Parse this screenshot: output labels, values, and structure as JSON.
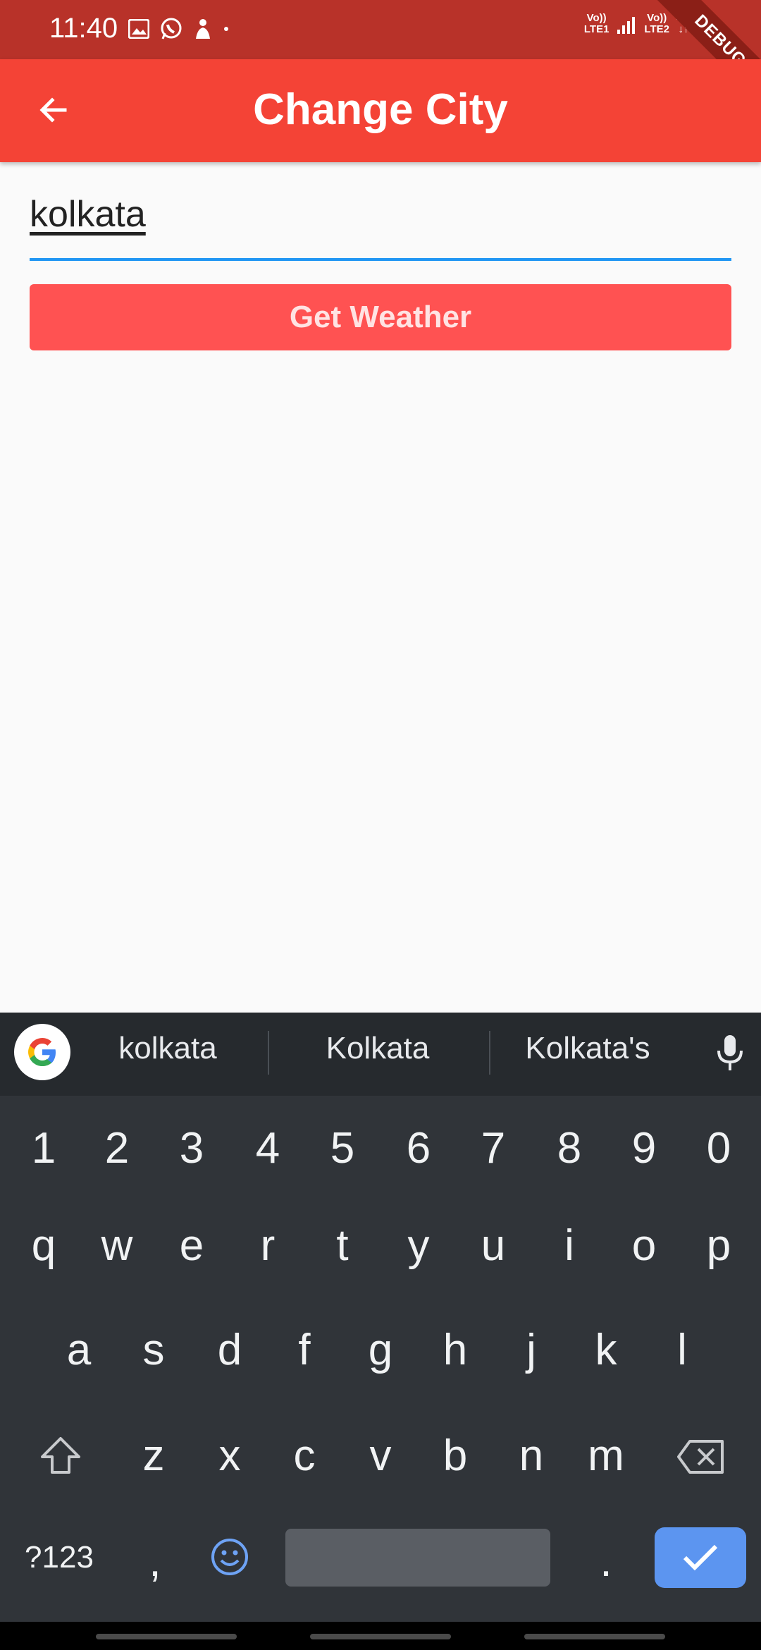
{
  "status_bar": {
    "time": "11:40",
    "net1": [
      "Vo))",
      "LTE1"
    ],
    "net2": [
      "Vo))",
      "LTE2"
    ],
    "net3": "4G",
    "debug": "DEBUG"
  },
  "app_bar": {
    "title": "Change City"
  },
  "form": {
    "city_value": "kolkata",
    "button_label": "Get Weather"
  },
  "keyboard": {
    "suggestions": [
      "kolkata",
      "Kolkata",
      "Kolkata's"
    ],
    "number_row": [
      "1",
      "2",
      "3",
      "4",
      "5",
      "6",
      "7",
      "8",
      "9",
      "0"
    ],
    "row1": [
      "q",
      "w",
      "e",
      "r",
      "t",
      "y",
      "u",
      "i",
      "o",
      "p"
    ],
    "row2": [
      "a",
      "s",
      "d",
      "f",
      "g",
      "h",
      "j",
      "k",
      "l"
    ],
    "row3": [
      "z",
      "x",
      "c",
      "v",
      "b",
      "n",
      "m"
    ],
    "symbols_key": "?123",
    "comma_key": ",",
    "period_key": "."
  },
  "colors": {
    "app_bar": "#f44336",
    "status_bar": "#b83229",
    "button": "#ff5252",
    "input_underline": "#2196f3",
    "keyboard_bg": "#303439",
    "enter_key": "#5c95f0"
  }
}
